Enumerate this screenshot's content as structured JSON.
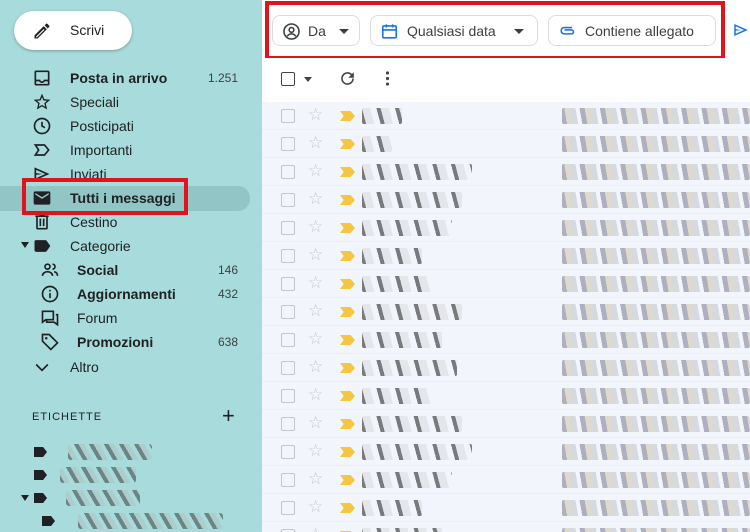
{
  "compose": {
    "label": "Scrivi"
  },
  "nav": {
    "inbox": {
      "label": "Posta in arrivo",
      "count": "1.251"
    },
    "starred": {
      "label": "Speciali"
    },
    "snoozed": {
      "label": "Posticipati"
    },
    "important": {
      "label": "Importanti"
    },
    "sent": {
      "label": "Inviati"
    },
    "all_mail": {
      "label": "Tutti i messaggi"
    },
    "trash": {
      "label": "Cestino"
    },
    "categories": {
      "label": "Categorie"
    },
    "social": {
      "label": "Social",
      "count": "146"
    },
    "updates": {
      "label": "Aggiornamenti",
      "count": "432"
    },
    "forums": {
      "label": "Forum"
    },
    "promotions": {
      "label": "Promozioni",
      "count": "638"
    },
    "more": {
      "label": "Altro"
    }
  },
  "labels": {
    "heading": "ETICHETTE",
    "add_icon": "plus-icon"
  },
  "filters": {
    "from": {
      "label": "Da"
    },
    "date": {
      "label": "Qualsiasi data"
    },
    "attachment": {
      "label": "Contiene allegato"
    }
  },
  "colors": {
    "sidebar_bg": "#a8dcdc",
    "active_bg": "#92c6c6",
    "highlight": "#e0141c",
    "important_marker": "#f5c543"
  }
}
